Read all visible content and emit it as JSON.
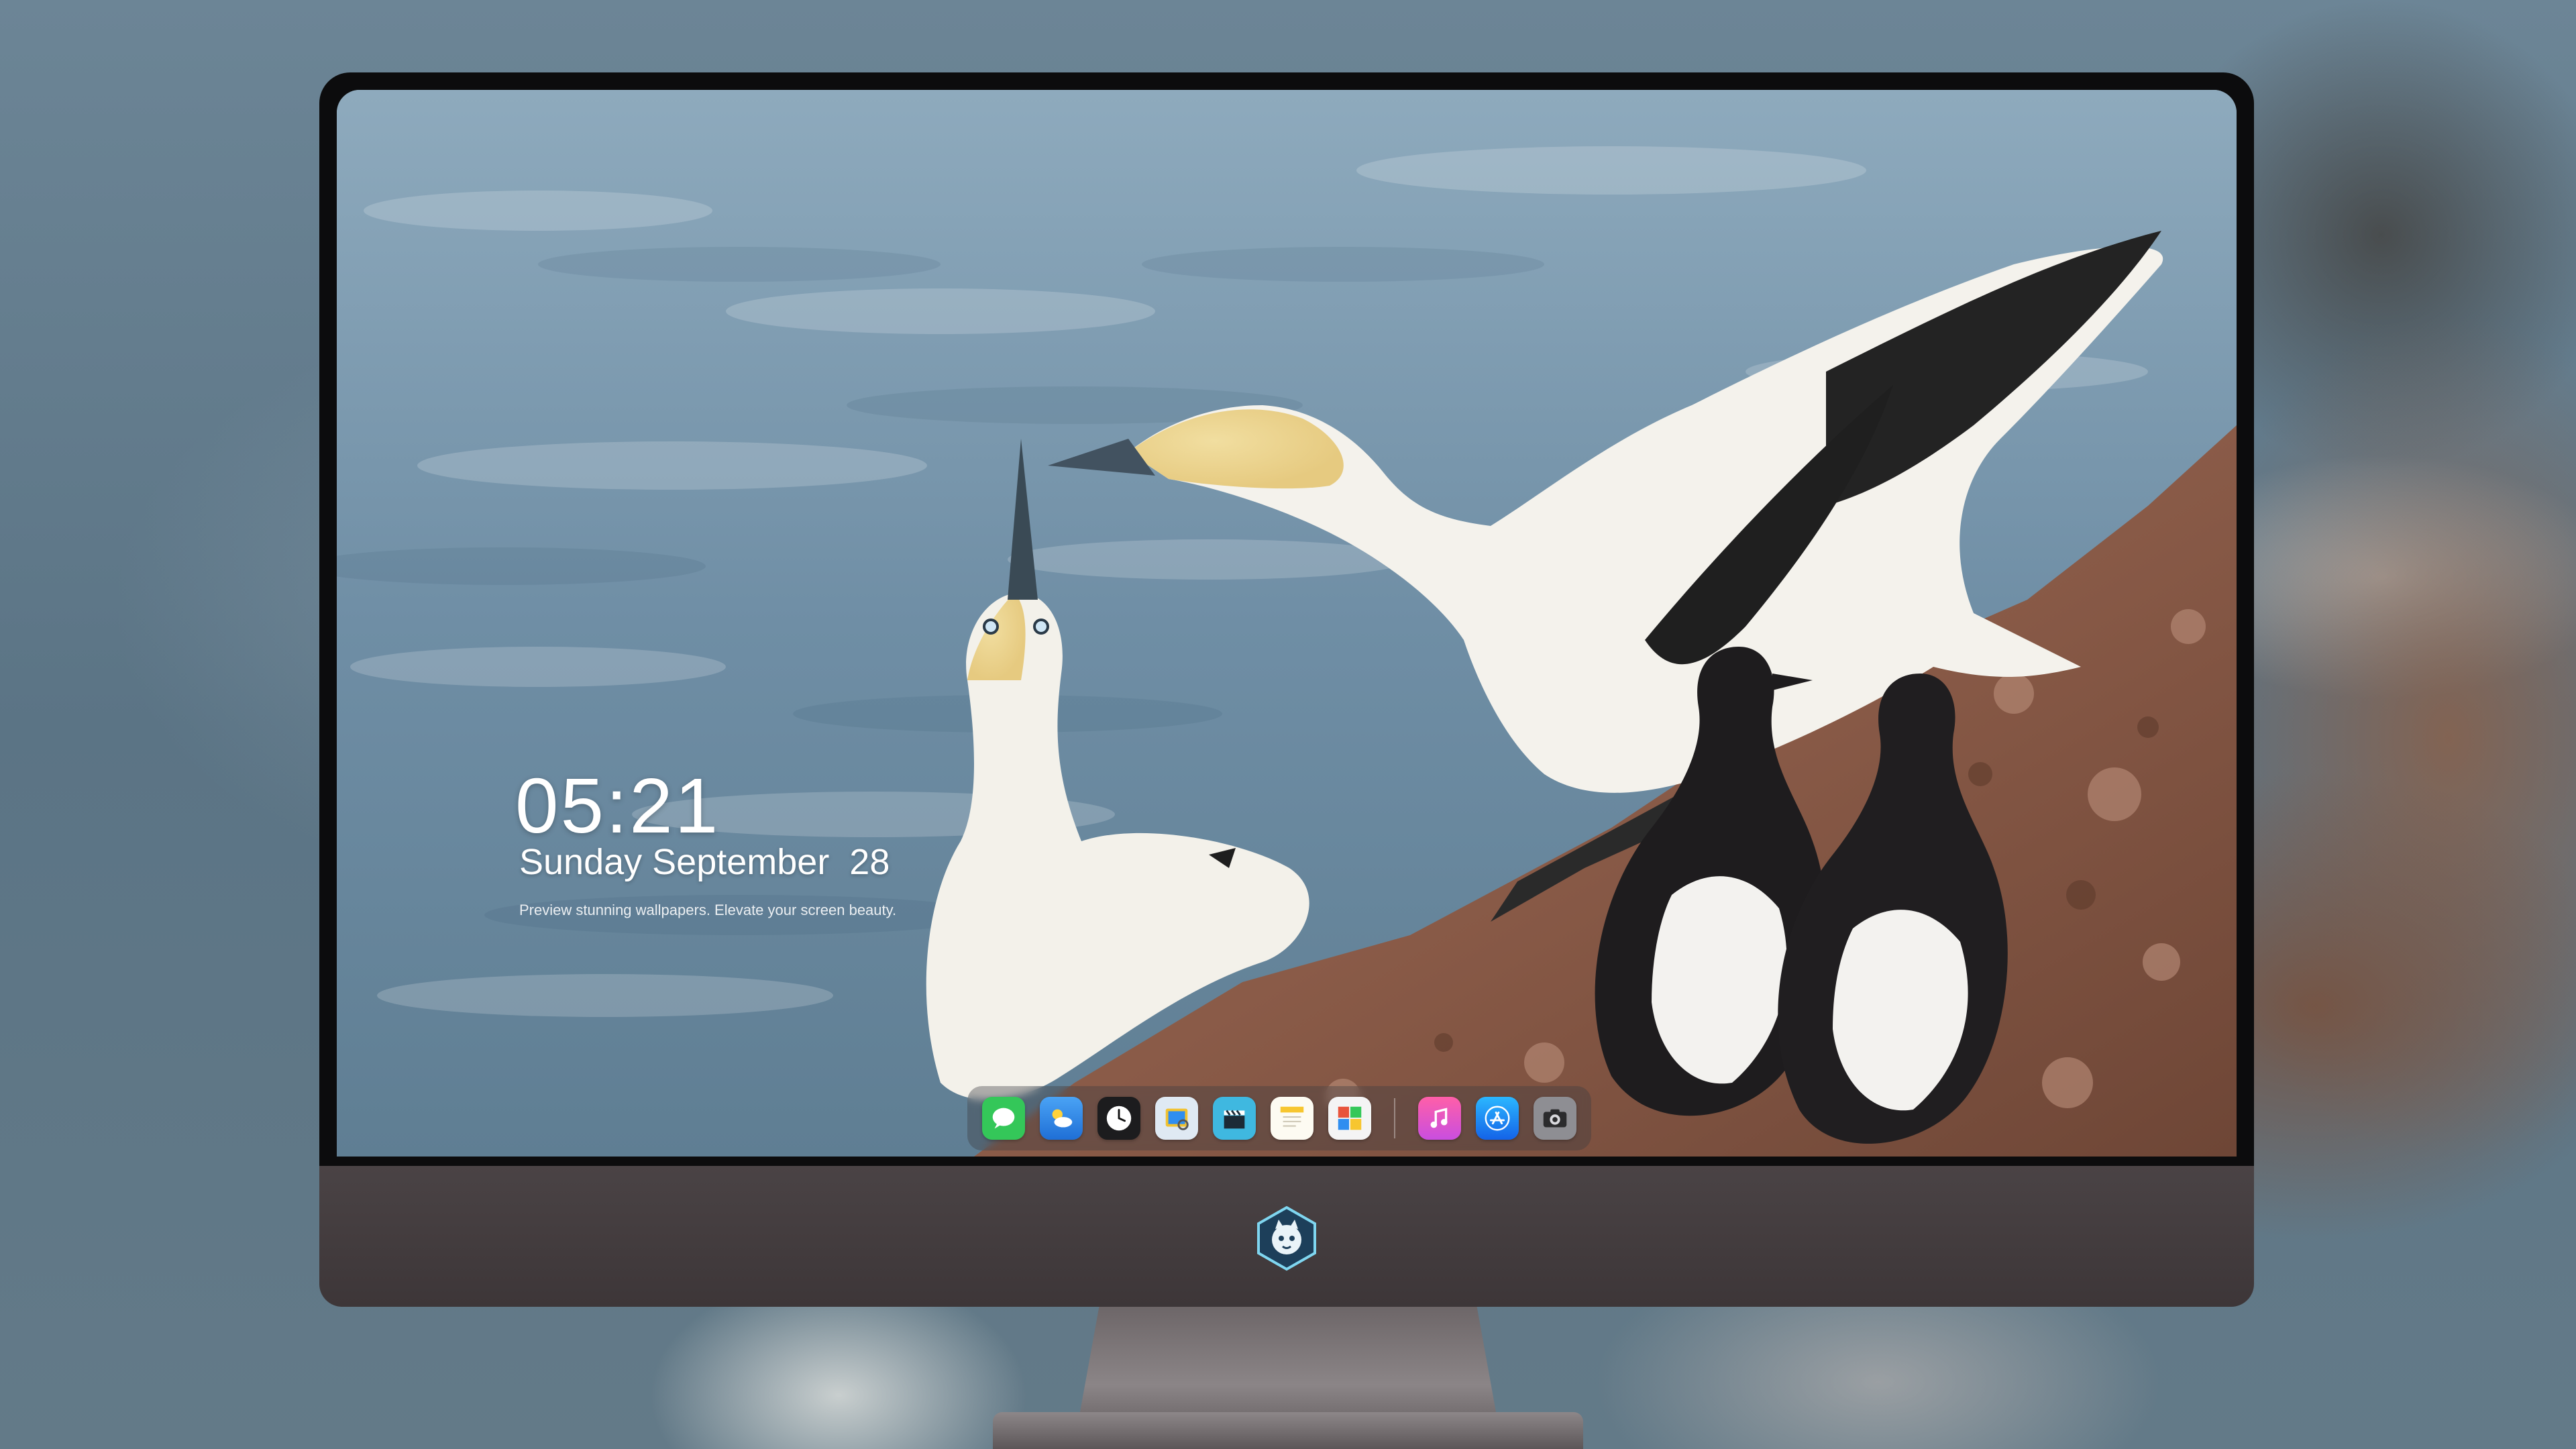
{
  "lock_screen": {
    "time": "05:21",
    "date": "Sunday September  28",
    "tagline": "Preview stunning wallpapers. Elevate your screen beauty."
  },
  "dock": {
    "apps": [
      {
        "name": "messages",
        "icon": "messages-icon",
        "color": "#34c759"
      },
      {
        "name": "weather",
        "icon": "weather-icon",
        "color": "#2f8ef0"
      },
      {
        "name": "clock",
        "icon": "clock-icon",
        "color": "#1c1c1e"
      },
      {
        "name": "preview",
        "icon": "preview-icon",
        "color": "#f2c230"
      },
      {
        "name": "clips",
        "icon": "clapperboard-icon",
        "color": "#3fb8e0"
      },
      {
        "name": "notes",
        "icon": "notes-icon",
        "color": "#f7d046"
      },
      {
        "name": "photo-booth",
        "icon": "photo-booth-icon",
        "color": "#e8543c"
      },
      {
        "name": "music",
        "icon": "music-icon",
        "color": "#fc3c8d"
      },
      {
        "name": "app-store",
        "icon": "app-store-icon",
        "color": "#1a8cff"
      },
      {
        "name": "camera",
        "icon": "camera-icon",
        "color": "#8e8e93"
      }
    ]
  },
  "colors": {
    "bezel": "#0c0c0d",
    "chin": "#433c3e",
    "sky": "#6f8fa6"
  }
}
